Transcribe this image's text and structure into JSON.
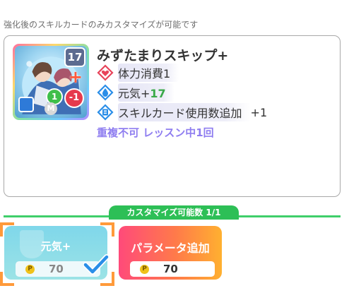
{
  "notice": "強化後のスキルカードのみカスタマイズが可能です",
  "card": {
    "cost": "17",
    "plus_mark": "+",
    "stat_green": "1",
    "stat_red": "-1",
    "m_mark": "M",
    "title": "みずたまりスキップ+",
    "effects": [
      {
        "icon": "heart-diamond-icon",
        "text": "体力消費1",
        "suffix": ""
      },
      {
        "icon": "genki-drop-icon",
        "text": "元気+",
        "value": "17",
        "suffix": ""
      },
      {
        "icon": "skill-card-icon",
        "text": "スキルカード使用数追加",
        "suffix": "+1"
      }
    ],
    "limit": "重複不可 レッスン中1回"
  },
  "customize": {
    "count_label": "カスタマイズ可能数 1/1",
    "options": [
      {
        "name": "元気+",
        "cost": "70",
        "selected": true
      },
      {
        "name": "パラメータ追加",
        "cost": "70",
        "selected": false
      }
    ],
    "coin_symbol": "P"
  },
  "colors": {
    "accent_green": "#2dbf56",
    "limit_purple": "#8f7ef0",
    "select_orange": "#ff9a3a",
    "check_blue": "#2a8ee8"
  }
}
